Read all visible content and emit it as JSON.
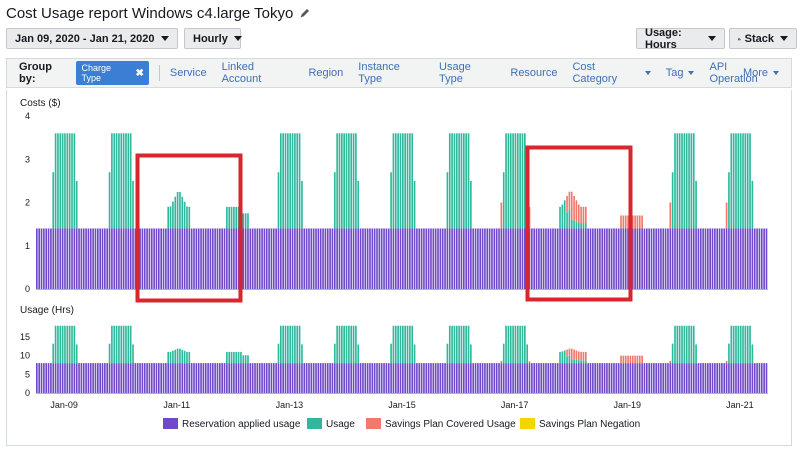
{
  "header": {
    "title": "Cost Usage report Windows c4.large Tokyo",
    "edit_icon": "pencil-icon"
  },
  "toolbar": {
    "date_range": "Jan 09, 2020 - Jan 21, 2020",
    "granularity": "Hourly",
    "usage_select": "Usage: Hours",
    "chart_style": "Stack",
    "chart_style_icon": "bar-chart-icon"
  },
  "group_by": {
    "label": "Group by:",
    "active_chip": "Charge Type",
    "items": [
      "Service",
      "Linked Account",
      "Region",
      "Instance Type",
      "Usage Type",
      "Resource",
      "Cost Category",
      "Tag",
      "API Operation"
    ],
    "items_with_dropdown": [
      "Cost Category",
      "Tag"
    ],
    "more": "More"
  },
  "colors": {
    "reservation": "#6f49c9",
    "usage": "#2fb89c",
    "savings_covered": "#f2786c",
    "savings_negation": "#f3d600",
    "highlight_box": "#d7262e"
  },
  "chart_data": [
    {
      "type": "bar",
      "stacked": true,
      "ylabel": "Costs ($)",
      "ylim": [
        0,
        4
      ],
      "yticks": [
        0,
        1,
        2,
        3,
        4
      ],
      "x_ticks": [
        "Jan-09",
        "Jan-11",
        "Jan-13",
        "Jan-15",
        "Jan-17",
        "Jan-19",
        "Jan-21"
      ],
      "series": [
        {
          "name": "Reservation applied usage",
          "constant": 1.4
        },
        {
          "name": "Usage",
          "workday_peak": 3.6,
          "weekend_peak": 2.3,
          "weekend_plateau": 1.9
        },
        {
          "name": "Savings Plan Covered Usage",
          "peak": 2.3,
          "plateau": 1.7
        },
        {
          "name": "Savings Plan Negation",
          "value": 0
        }
      ]
    },
    {
      "type": "bar",
      "stacked": true,
      "ylabel": "Usage (Hrs)",
      "ylim": [
        0,
        19
      ],
      "yticks": [
        0,
        5,
        10,
        15
      ],
      "x_ticks": [
        "Jan-09",
        "Jan-11",
        "Jan-13",
        "Jan-15",
        "Jan-17",
        "Jan-19",
        "Jan-21"
      ],
      "series": [
        {
          "name": "Reservation applied usage",
          "constant": 8
        },
        {
          "name": "Usage",
          "workday_peak": 18,
          "weekend_peak": 12,
          "weekend_plateau": 11
        },
        {
          "name": "Savings Plan Covered Usage",
          "peak": 12,
          "plateau": 10
        },
        {
          "name": "Savings Plan Negation",
          "value": 0
        }
      ]
    }
  ],
  "legend": [
    {
      "label": "Reservation applied usage",
      "color": "#6f49c9"
    },
    {
      "label": "Usage",
      "color": "#2fb89c"
    },
    {
      "label": "Savings Plan Covered Usage",
      "color": "#f2786c"
    },
    {
      "label": "Savings Plan Negation",
      "color": "#f3d600"
    }
  ]
}
